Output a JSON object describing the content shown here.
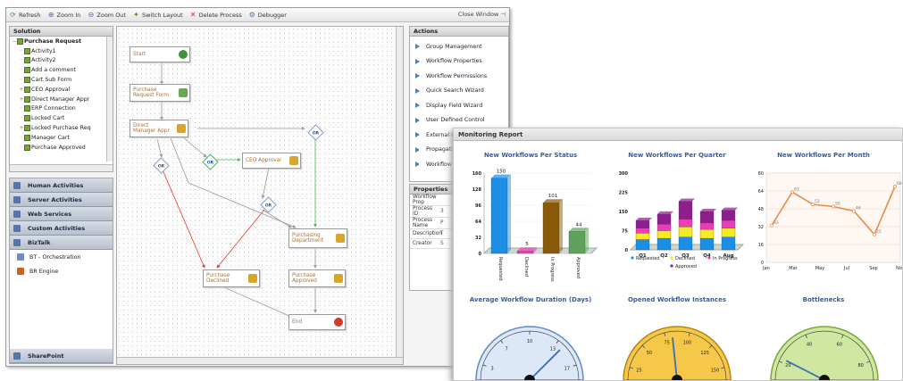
{
  "toolbar": {
    "refresh": "Refresh",
    "zoom_in": "Zoom In",
    "zoom_out": "Zoom Out",
    "switch_layout": "Switch Layout",
    "delete_process": "Delete Process",
    "debugger": "Debugger",
    "close_window": "Close Window"
  },
  "solution": {
    "title": "Solution",
    "root": "Purchase Request",
    "items": [
      "Activity1",
      "Activity2",
      "Add a comment",
      "Cart Sub Form",
      "CEO Approval",
      "Direct Manager Appr",
      "ERP Connection",
      "Locked Cart",
      "Locked Purchase Req",
      "Manager Cart",
      "Purchase Approved"
    ]
  },
  "accordion": {
    "headers": [
      "Human Activities",
      "Server Activities",
      "Web Services",
      "Custom Activities",
      "BizTalk"
    ],
    "biztalk_items": [
      "BT - Orchestration",
      "BR Engine"
    ],
    "sharepoint": "SharePoint"
  },
  "workflow": {
    "start": "Start",
    "purchase_request_form": [
      "Purchase",
      "Request Form"
    ],
    "direct_manager": [
      "Direct",
      "Manager Appr"
    ],
    "ceo_approval": "CEO Approval",
    "purchasing_department": [
      "Purchasing",
      "Department"
    ],
    "purchase_declined": [
      "Purchase",
      "Declined"
    ],
    "purchase_approved": [
      "Purchase",
      "Approved"
    ],
    "end": "End",
    "or": "OR"
  },
  "actions": {
    "title": "Actions",
    "items": [
      "Group Management",
      "Workflow Properties",
      "Workflow Permissions",
      "Quick Search Wizard",
      "Display Field Wizard",
      "User Defined Control",
      "External C",
      "Propagati",
      "Workflow"
    ]
  },
  "properties": {
    "title": "Properties",
    "rows": [
      {
        "k": "Workflow Prop",
        "v": ""
      },
      {
        "k": "Process ID",
        "v": "3"
      },
      {
        "k": "Process Name",
        "v": "P"
      },
      {
        "k": "Description",
        "v": "T"
      },
      {
        "k": "Creator",
        "v": "S"
      }
    ]
  },
  "report": {
    "title": "Monitoring Report",
    "colors": {
      "blue": "#1c8ee6",
      "pink": "#e83fb7",
      "brown": "#8a5a08",
      "green": "#5ea35a",
      "yellow": "#f4ea26",
      "purple": "#8c1f8c",
      "orange": "#e9894a"
    }
  },
  "chart_data": [
    {
      "type": "bar",
      "title": "New Workflows Per Status",
      "categories": [
        "Requested",
        "Declined",
        "In Progress",
        "Approved"
      ],
      "values": [
        150,
        5,
        101,
        44
      ],
      "ylim": [
        0,
        160
      ],
      "yticks": [
        0,
        32,
        64,
        96,
        128,
        160
      ]
    },
    {
      "type": "bar",
      "title": "New Workflows Per Quarter",
      "stacked": true,
      "categories": [
        "Q1",
        "Q2",
        "Q3",
        "Q4",
        "Aug"
      ],
      "yticks": [
        0,
        75,
        150,
        225,
        300
      ],
      "ylim": [
        0,
        300
      ],
      "series": [
        {
          "name": "Requested",
          "values": [
            40,
            45,
            50,
            45,
            50
          ]
        },
        {
          "name": "Declined",
          "values": [
            25,
            30,
            40,
            35,
            35
          ]
        },
        {
          "name": "In Progress",
          "values": [
            20,
            25,
            30,
            25,
            30
          ]
        },
        {
          "name": "Approved",
          "values": [
            30,
            40,
            70,
            45,
            40
          ]
        }
      ]
    },
    {
      "type": "line",
      "title": "New Workflows Per Month",
      "x": [
        "Jan",
        "Mar",
        "May",
        "Jul",
        "Sep",
        "Nov"
      ],
      "values": [
        33,
        63,
        52,
        50,
        46,
        25,
        68
      ],
      "yticks": [
        0,
        16,
        32,
        48,
        64,
        80
      ],
      "ylim": [
        0,
        80
      ]
    },
    {
      "type": "gauge",
      "title": "Average Workflow Duration (Days)",
      "ticks": [
        "3",
        "7",
        "10",
        "13",
        "17"
      ],
      "value": 15
    },
    {
      "type": "gauge",
      "title": "Opened Workflow Instances",
      "ticks": [
        "25",
        "50",
        "75",
        "100",
        "125",
        "150"
      ],
      "value": 70
    },
    {
      "type": "gauge",
      "title": "Bottlenecks",
      "ticks": [
        "20",
        "40",
        "60",
        "80"
      ],
      "value": 15
    }
  ]
}
